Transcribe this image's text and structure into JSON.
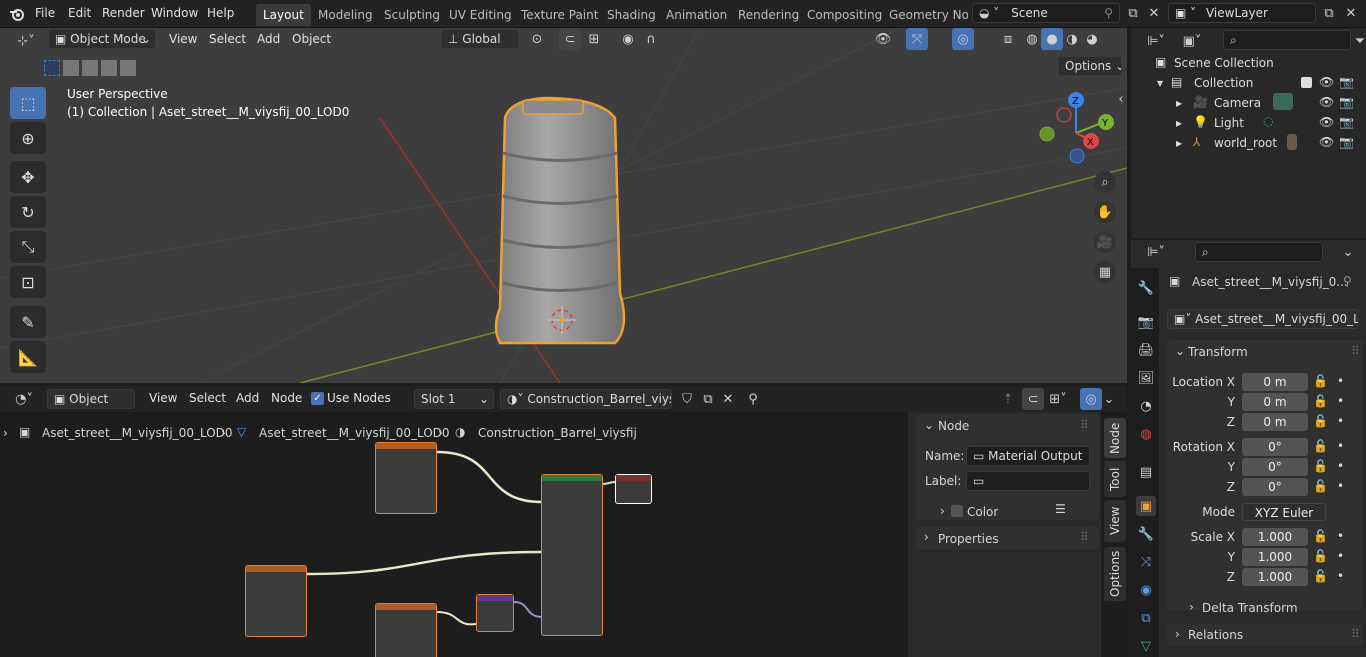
{
  "topbar": {
    "menus": [
      "File",
      "Edit",
      "Render",
      "Window",
      "Help"
    ],
    "workspaces": [
      "Layout",
      "Modeling",
      "Sculpting",
      "UV Editing",
      "Texture Paint",
      "Shading",
      "Animation",
      "Rendering",
      "Compositing",
      "Geometry Noc"
    ],
    "active_workspace": "Layout",
    "scene": "Scene",
    "view_layer": "ViewLayer"
  },
  "viewport_header": {
    "mode": "Object Mode",
    "menus": [
      "View",
      "Select",
      "Add",
      "Object"
    ],
    "orientation": "Global",
    "options": "Options"
  },
  "viewport": {
    "perspective": "User Perspective",
    "collection_info": "(1) Collection | Aset_street__M_viysfij_00_LOD0",
    "gizmo": {
      "z": "Z",
      "y": "Y",
      "x": "X"
    }
  },
  "outliner": {
    "root": "Scene Collection",
    "items": [
      {
        "label": "Collection",
        "icon": "collection-icon"
      },
      {
        "label": "Camera",
        "icon": "camera-icon"
      },
      {
        "label": "Light",
        "icon": "light-icon"
      },
      {
        "label": "world_root",
        "icon": "empty-icon"
      }
    ]
  },
  "properties": {
    "object_name": "Aset_street__M_viysfij_0...",
    "data_name": "Aset_street__M_viysfij_00_L...",
    "transform_title": "Transform",
    "location": {
      "label": "Location X",
      "x": "0 m",
      "y": "0 m",
      "z": "0 m"
    },
    "rotation": {
      "label": "Rotation X",
      "x": "0°",
      "y": "0°",
      "z": "0°"
    },
    "mode_label": "Mode",
    "mode_value": "XYZ Euler",
    "scale": {
      "label": "Scale X",
      "x": "1.000",
      "y": "1.000",
      "z": "1.000"
    },
    "axis_y": "Y",
    "axis_z": "Z",
    "delta_transform": "Delta Transform",
    "relations": "Relations"
  },
  "node_header": {
    "editor_type": "Object",
    "menus": [
      "View",
      "Select",
      "Add",
      "Node"
    ],
    "use_nodes": "Use Nodes",
    "slot": "Slot 1",
    "material": "Construction_Barrel_viysfij"
  },
  "breadcrumb": [
    "Aset_street__M_viysfij_00_LOD0",
    "Aset_street__M_viysfij_00_LOD0",
    "Construction_Barrel_viysfij"
  ],
  "node_sidebar": {
    "section": "Node",
    "name_label": "Name:",
    "name_value": "Material Output",
    "label_label": "Label:",
    "label_value": "",
    "color": "Color",
    "properties": "Properties",
    "tabs": [
      "Node",
      "Tool",
      "View",
      "Options"
    ]
  },
  "colors": {
    "accent": "#4772b3",
    "selection": "#f0a030",
    "node_header": "#b35a22"
  }
}
